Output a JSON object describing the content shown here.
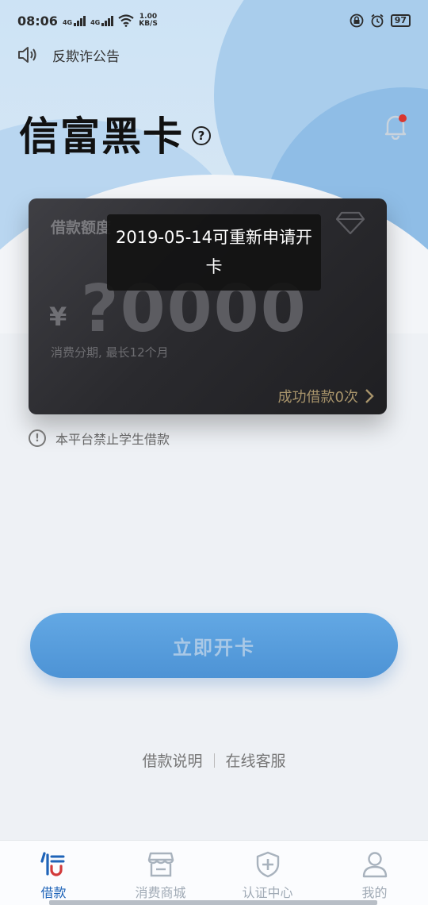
{
  "status_bar": {
    "time": "08:06",
    "network_1": "4G",
    "network_2": "4G",
    "speed_value": "1.00",
    "speed_unit": "KB/S",
    "battery": "97"
  },
  "notice": {
    "text": "反欺诈公告"
  },
  "header": {
    "title": "信富黑卡",
    "help_symbol": "?"
  },
  "card": {
    "label": "借款额度",
    "currency": "¥",
    "amount": "?0000",
    "subtitle": "消费分期, 最长12个月",
    "success_text": "成功借款0次"
  },
  "toast": {
    "message": "2019-05-14可重新申请开卡"
  },
  "warning": {
    "text": "本平台禁止学生借款",
    "symbol": "!"
  },
  "cta": {
    "label": "立即开卡"
  },
  "footer_links": {
    "left": "借款说明",
    "right": "在线客服"
  },
  "tabs": [
    {
      "label": "借款",
      "icon": "loan-logo-icon",
      "active": true
    },
    {
      "label": "消费商城",
      "icon": "shop-icon",
      "active": false
    },
    {
      "label": "认证中心",
      "icon": "shield-plus-icon",
      "active": false
    },
    {
      "label": "我的",
      "icon": "user-icon",
      "active": false
    }
  ],
  "colors": {
    "accent": "#1e63b8",
    "cta_bg": "#4d93d5",
    "card_bg": "#2a2a2e",
    "success_text": "#a8946b"
  }
}
